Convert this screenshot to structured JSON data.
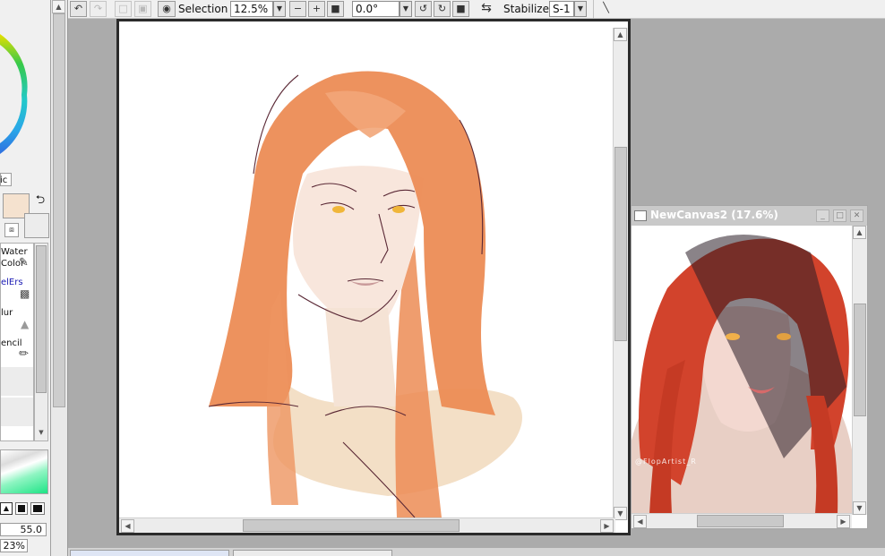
{
  "toolbar": {
    "selection_label": "Selection",
    "zoom_value": "12.5%",
    "rotation_value": "0.0°",
    "stabilizer_label": "Stabilizer",
    "stabilizer_value": "S-1"
  },
  "left_panel": {
    "mode_label": "ic",
    "tools": [
      {
        "label_line1": "Water",
        "label_line2": "Color"
      },
      {
        "label_line1": "elErs",
        "label_line2": ""
      },
      {
        "label_line1": "lur",
        "label_line2": ""
      },
      {
        "label_line1": "encil",
        "label_line2": ""
      }
    ],
    "brush_size_value": "55.0",
    "brush_density_value": "23%"
  },
  "colors": {
    "primary": "#f5e2cf",
    "toolbar_bg": "#f0f0f0",
    "workspace_bg": "#ababab",
    "active_tool": "#1a1ab3"
  },
  "secondary_window": {
    "title": "NewCanvas2 (17.6%)",
    "watermark": "@FlopArtist_R"
  }
}
